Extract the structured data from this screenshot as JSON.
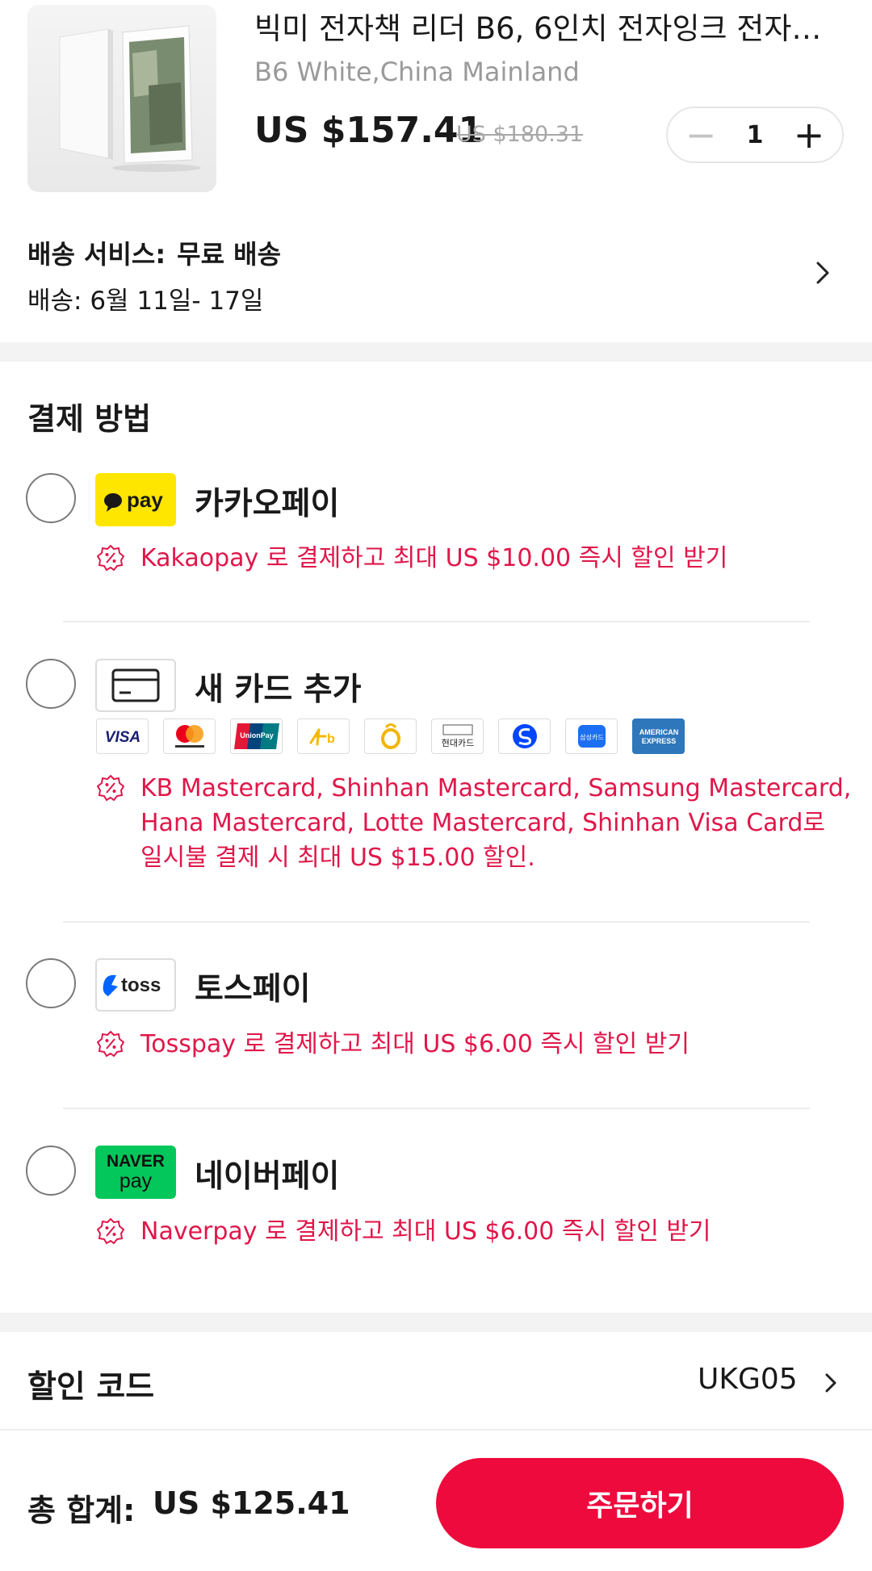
{
  "product": {
    "title": "빅미 전자책 리더 B6, 6인치 전자잉크 전자책, …",
    "variant": "B6 White,China Mainland",
    "price": "US $157.41",
    "original_price": "US $180.31",
    "quantity": "1",
    "minus_symbol": "−",
    "plus_symbol": "+"
  },
  "shipping": {
    "service_label": "배송 서비스:",
    "service_value": "무료 배송",
    "date": "배송: 6월 11일- 17일"
  },
  "payment": {
    "title": "결제 방법",
    "methods": [
      {
        "name": "카카오페이",
        "logo_text": "pay",
        "logo_color": "#FFE600",
        "promo": "Kakaopay 로 결제하고 최대 US $10.00 즉시 할인 받기"
      },
      {
        "name": "새 카드 추가",
        "logo_icon": "credit-card-icon",
        "cards": [
          "VISA",
          "Mastercard",
          "UnionPay",
          "KB",
          "NH",
          "현대카드",
          "Shinhan",
          "삼성카드",
          "AMERICAN EXPRESS"
        ],
        "promo_lines": [
          "KB Mastercard, Shinhan Mastercard, Samsung Mastercard,",
          "Hana Mastercard, Lotte Mastercard, Shinhan Visa Card로",
          "일시불 결제 시 최대 US $15.00 할인."
        ]
      },
      {
        "name": "토스페이",
        "logo_text": "toss",
        "logo_color": "#0064FF",
        "promo": "Tosspay 로 결제하고 최대 US $6.00 즉시 할인 받기"
      },
      {
        "name": "네이버페이",
        "logo_text_top": "NAVER",
        "logo_text_bottom": "pay",
        "logo_color": "#03C75A",
        "promo": "Naverpay 로 결제하고 최대 US $6.00 즉시 할인 받기"
      }
    ]
  },
  "discount": {
    "label": "할인 코드",
    "value": "UKG05"
  },
  "footer": {
    "total_label": "총 합계:",
    "total_value": "US $125.41",
    "order_button": "주문하기"
  },
  "colors": {
    "accent": "#EE0A3C",
    "promo": "#E0174A"
  }
}
